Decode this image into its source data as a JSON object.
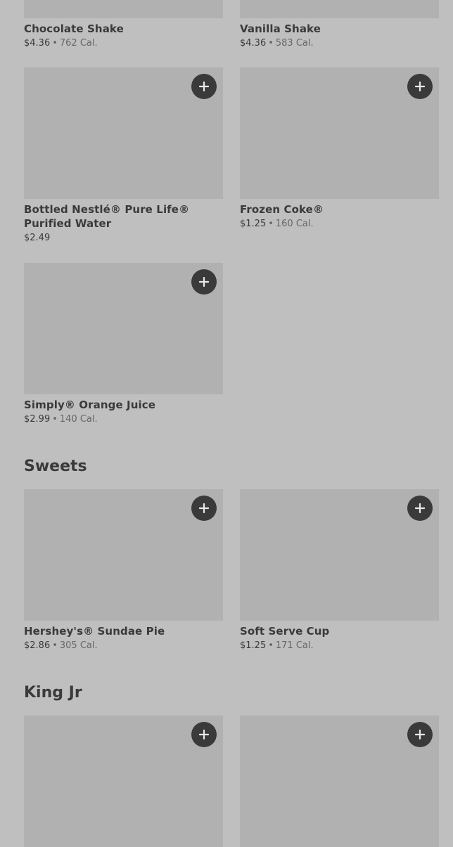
{
  "sections": [
    {
      "title": "",
      "items": [
        {
          "name": "Chocolate Shake",
          "price": "$4.36",
          "calories": "762 Cal."
        },
        {
          "name": "Vanilla Shake",
          "price": "$4.36",
          "calories": "583 Cal."
        },
        {
          "name": "Bottled Nestlé® Pure Life® Purified Water",
          "price": "$2.49",
          "calories": ""
        },
        {
          "name": "Frozen Coke®",
          "price": "$1.25",
          "calories": "160 Cal."
        },
        {
          "name": "Simply® Orange Juice",
          "price": "$2.99",
          "calories": "140 Cal."
        }
      ]
    },
    {
      "title": "Sweets",
      "items": [
        {
          "name": "Hershey's® Sundae Pie",
          "price": "$2.86",
          "calories": "305 Cal."
        },
        {
          "name": "Soft Serve Cup",
          "price": "$1.25",
          "calories": "171 Cal."
        }
      ]
    },
    {
      "title": "King Jr",
      "items": [
        {
          "name": "",
          "price": "",
          "calories": ""
        },
        {
          "name": "",
          "price": "",
          "calories": ""
        }
      ]
    }
  ],
  "separator": "•",
  "icons": {
    "add": "plus-icon"
  }
}
